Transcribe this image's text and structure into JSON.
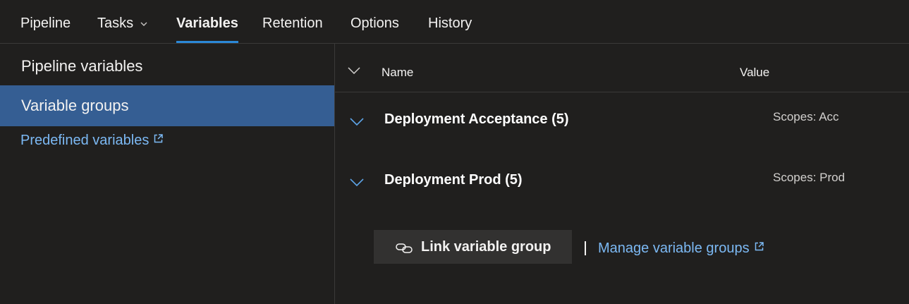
{
  "tabs": [
    {
      "label": "Pipeline",
      "active": false
    },
    {
      "label": "Tasks",
      "active": false,
      "has_dropdown": true
    },
    {
      "label": "Variables",
      "active": true
    },
    {
      "label": "Retention",
      "active": false
    },
    {
      "label": "Options",
      "active": false
    },
    {
      "label": "History",
      "active": false
    }
  ],
  "sidebar": {
    "items": [
      {
        "label": "Pipeline variables",
        "selected": false
      },
      {
        "label": "Variable groups",
        "selected": true
      }
    ],
    "predefined_link": "Predefined variables"
  },
  "table": {
    "header_name": "Name",
    "header_value": "Value",
    "groups": [
      {
        "name": "Deployment Acceptance (5)",
        "scope": "Scopes: Acc"
      },
      {
        "name": "Deployment Prod (5)",
        "scope": "Scopes: Prod"
      }
    ]
  },
  "actions": {
    "link_button": "Link variable group",
    "manage_link": "Manage variable groups"
  },
  "colors": {
    "background": "#201f1e",
    "selected_nav": "#355e93",
    "accent": "#2b88d8",
    "link": "#7cb9f4",
    "button_bg": "#323130"
  },
  "icons": {
    "tasks_dropdown": "chevron-down-icon",
    "external": "external-link-icon",
    "collapse_all": "chevron-down-icon",
    "group_expand": "chevron-down-icon",
    "link": "link-icon"
  }
}
